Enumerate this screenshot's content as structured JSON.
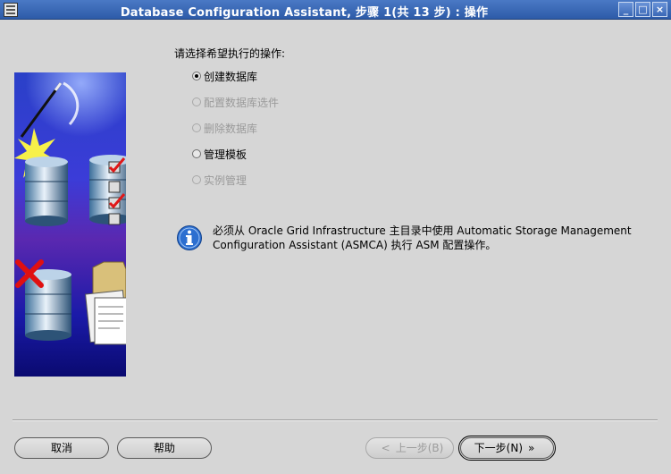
{
  "window": {
    "title": "Database Configuration Assistant, 步骤 1(共 13 步) : 操作",
    "controls": {
      "minimize": "_",
      "maximize": "□",
      "close": "×"
    }
  },
  "main": {
    "prompt": "请选择希望执行的操作:",
    "options": [
      {
        "label": "创建数据库",
        "selected": true,
        "enabled": true
      },
      {
        "label": "配置数据库选件",
        "selected": false,
        "enabled": false
      },
      {
        "label": "删除数据库",
        "selected": false,
        "enabled": false
      },
      {
        "label": "管理模板",
        "selected": false,
        "enabled": true
      },
      {
        "label": "实例管理",
        "selected": false,
        "enabled": false
      }
    ],
    "info_line1": "必须从 Oracle Grid Infrastructure 主目录中使用 Automatic Storage Management",
    "info_line2": "Configuration Assistant (ASMCA) 执行 ASM 配置操作。"
  },
  "footer": {
    "cancel_label": "取消",
    "help_label": "帮助",
    "back_label": "上一步(B)",
    "back_glyph": "<",
    "next_label": "下一步(N)",
    "next_glyph": "»"
  },
  "colors": {
    "titlebar": "#2d5ba8",
    "dialog_bg": "#d6d6d6",
    "disabled_text": "#9a9a9a"
  },
  "icons": [
    "window-menu-icon",
    "minimize-icon",
    "maximize-icon",
    "close-icon",
    "info-icon",
    "database-icon",
    "checkmark-icon",
    "folder-icon",
    "delete-x-icon",
    "magic-wand-icon"
  ]
}
